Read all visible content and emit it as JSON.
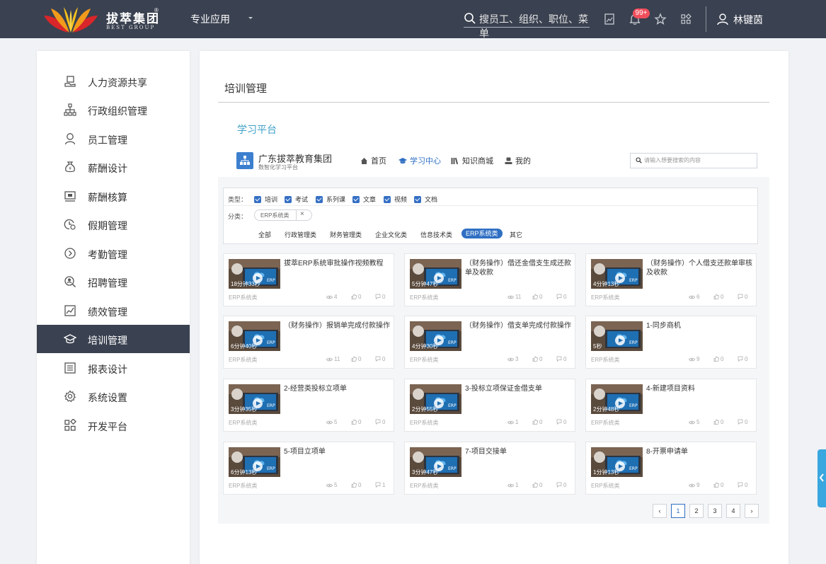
{
  "topbar": {
    "logo_text": "拔萃集团",
    "logo_sub": "BEST GROUP",
    "logo_reg": "®",
    "app_switch": "专业应用",
    "search_placeholder": "搜员工、组织、职位、菜单",
    "notification_badge": "99+",
    "user_name": "林键茵",
    "bg_color": "#3a4150"
  },
  "sidebar": {
    "items": [
      {
        "label": "人力资源共享",
        "icon": "hr-share-icon"
      },
      {
        "label": "行政组织管理",
        "icon": "org-chart-icon"
      },
      {
        "label": "员工管理",
        "icon": "person-icon"
      },
      {
        "label": "薪酬设计",
        "icon": "money-bag-icon"
      },
      {
        "label": "薪酬核算",
        "icon": "payroll-icon"
      },
      {
        "label": "假期管理",
        "icon": "leave-clock-icon"
      },
      {
        "label": "考勤管理",
        "icon": "attendance-icon"
      },
      {
        "label": "招聘管理",
        "icon": "recruit-icon"
      },
      {
        "label": "绩效管理",
        "icon": "performance-chart-icon"
      },
      {
        "label": "培训管理",
        "icon": "graduation-cap-icon",
        "active": true
      },
      {
        "label": "报表设计",
        "icon": "report-icon"
      },
      {
        "label": "系统设置",
        "icon": "gear-icon"
      },
      {
        "label": "开发平台",
        "icon": "apps-grid-icon"
      }
    ]
  },
  "main": {
    "title": "培训管理",
    "platform_label": "学习平台",
    "org": {
      "name": "广东拔萃教育集团",
      "subtitle": "数智化学习平台"
    },
    "nav": [
      {
        "label": "首页",
        "icon": "home-icon"
      },
      {
        "label": "学习中心",
        "icon": "graduation-cap-icon",
        "active": true
      },
      {
        "label": "知识商城",
        "icon": "books-icon"
      },
      {
        "label": "我的",
        "icon": "user-icon"
      }
    ],
    "search_placeholder": "请输入想要搜索的内容",
    "filters": {
      "type_label": "类型：",
      "types": [
        "培训",
        "考试",
        "系列课",
        "文章",
        "视频",
        "文档"
      ],
      "category_label": "分类：",
      "selected_tag": "ERP系统类",
      "categories": [
        "全部",
        "行政管理类",
        "财务管理类",
        "企业文化类",
        "信息技术类",
        "ERP系统类",
        "其它"
      ],
      "active_category": "ERP系统类"
    },
    "courses": [
      {
        "title": "拔萃ERP系统审批操作视频教程",
        "duration": "18分钟33秒",
        "category": "ERP系统类",
        "views": "4",
        "likes": "0",
        "comments": "0"
      },
      {
        "title": "（财务操作）借还金借支生成还款单及收款",
        "duration": "5分钟47秒",
        "category": "ERP系统类",
        "views": "11",
        "likes": "0",
        "comments": "0"
      },
      {
        "title": "（财务操作）个人借支还款单审核及收款",
        "duration": "4分钟13秒",
        "category": "ERP系统类",
        "views": "6",
        "likes": "0",
        "comments": "0"
      },
      {
        "title": "（财务操作）报销单完成付款操作",
        "duration": "6分钟40秒",
        "category": "ERP系统类",
        "views": "11",
        "likes": "0",
        "comments": "0"
      },
      {
        "title": "（财务操作）借支单完成付款操作",
        "duration": "4分钟30秒",
        "category": "ERP系统类",
        "views": "3",
        "likes": "0",
        "comments": "0"
      },
      {
        "title": "1-同步商机",
        "duration": "5秒",
        "category": "ERP系统类",
        "views": "9",
        "likes": "0",
        "comments": "0"
      },
      {
        "title": "2-经营类投标立项单",
        "duration": "3分钟35秒",
        "category": "ERP系统类",
        "views": "5",
        "likes": "0",
        "comments": "0"
      },
      {
        "title": "3-投标立项保证金借支单",
        "duration": "2分钟55秒",
        "category": "ERP系统类",
        "views": "1",
        "likes": "0",
        "comments": "0"
      },
      {
        "title": "4-新建项目资料",
        "duration": "2分钟48秒",
        "category": "ERP系统类",
        "views": "5",
        "likes": "0",
        "comments": "0"
      },
      {
        "title": "5-项目立项单",
        "duration": "6分钟13秒",
        "category": "ERP系统类",
        "views": "5",
        "likes": "0",
        "comments": "1"
      },
      {
        "title": "7-项目交接单",
        "duration": "3分钟47秒",
        "category": "ERP系统类",
        "views": "1",
        "likes": "0",
        "comments": "0"
      },
      {
        "title": "8-开票申请单",
        "duration": "1分钟13秒",
        "category": "ERP系统类",
        "views": "9",
        "likes": "0",
        "comments": "0"
      }
    ],
    "pagination": {
      "prev": "‹",
      "pages": [
        "1",
        "2",
        "3",
        "4"
      ],
      "next": "›",
      "current": "1"
    }
  },
  "colors": {
    "accent": "#2f6fc3",
    "teal": "#3fa0c8",
    "side_tab": "#3aa7df"
  }
}
